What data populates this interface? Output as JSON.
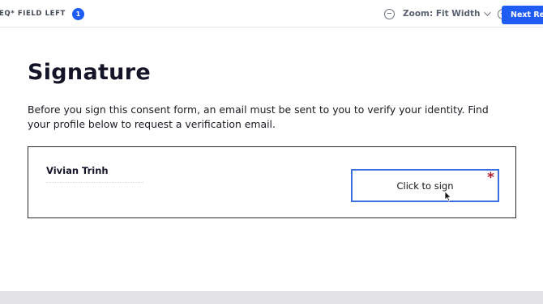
{
  "toolbar": {
    "fields_left_label": "EQ* FIELD LEFT",
    "fields_left_count": "1",
    "zoom_label": "Zoom: Fit Width",
    "next_button_label": "Next Req"
  },
  "content": {
    "title": "Signature",
    "intro": "Before you sign this consent form, an email must be sent to you to verify your identity. Find your profile below to request a verification email."
  },
  "signature_block": {
    "signer_name": "Vivian Trinh",
    "sign_button_label": "Click to sign",
    "required_marker": "*"
  },
  "colors": {
    "accent": "#1f5cf4",
    "required": "#b01c2c",
    "sign_border": "#3c6fe0"
  },
  "icons": [
    "zoom-out-icon",
    "chevron-down-icon",
    "zoom-in-icon",
    "mouse-cursor-icon"
  ]
}
